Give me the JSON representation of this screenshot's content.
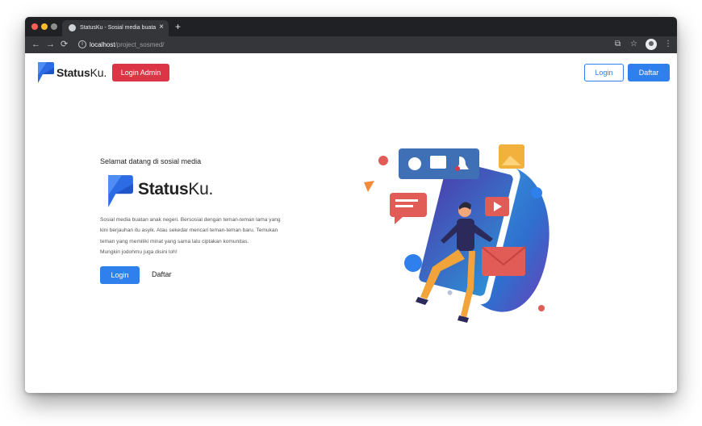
{
  "browser": {
    "tab_title": "StatusKu - Sosial media buatan anak negeri",
    "tab_close": "×",
    "new_tab": "+",
    "url_host": "localhost",
    "url_path": "/project_sosmed/",
    "nav_back": "←",
    "nav_forward": "→",
    "nav_reload": "⟳",
    "star": "☆",
    "menu": "⋮",
    "translate": "⧉",
    "info": "i"
  },
  "navbar": {
    "brand_bold": "Status",
    "brand_light": "Ku.",
    "admin_label": "Login Admin",
    "login_label": "Login",
    "register_label": "Daftar"
  },
  "hero": {
    "welcome": "Selamat datang di sosial media",
    "brand_bold": "Status",
    "brand_light": "Ku.",
    "description": [
      "Sosial media buatan anak negeri. Bersosial dengan teman-teman lama yang",
      "kini berjauhan itu asyik. Atau sekedar mencari teman-teman baru. Temukan",
      "teman yang memiliki minat yang sama lalu ciptakan komunitas.",
      "Mungkin jodohmu juga disini loh!"
    ],
    "login_label": "Login",
    "register_label": "Daftar"
  },
  "colors": {
    "primary": "#2f80ed",
    "danger": "#dc3545",
    "brand_blue": "#2d6be4",
    "chrome_dark": "#202124",
    "chrome_tab": "#35363a"
  },
  "icons": [
    "close-icon",
    "plus-icon",
    "back-arrow-icon",
    "forward-arrow-icon",
    "reload-icon",
    "info-icon",
    "translate-icon",
    "star-icon",
    "profile-avatar-icon",
    "menu-dots-icon",
    "statusku-logo-icon"
  ]
}
